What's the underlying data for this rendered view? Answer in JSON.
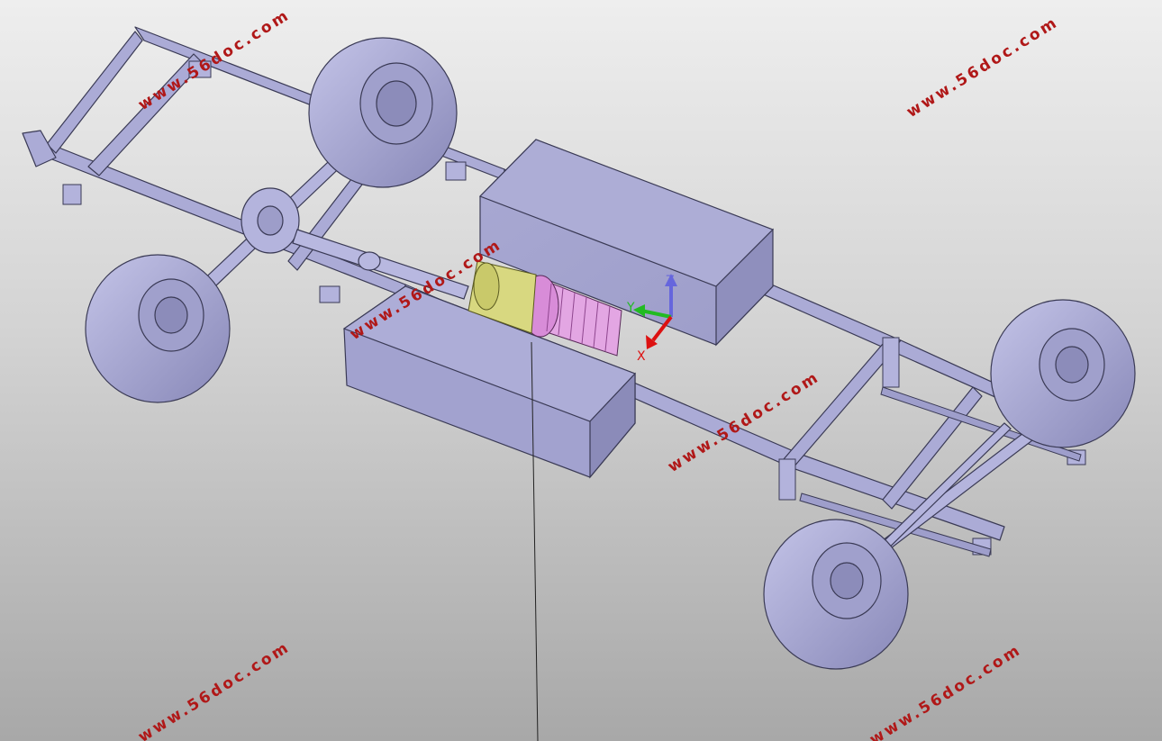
{
  "viewport": {
    "background_top": "#eeeeee",
    "background_bottom": "#a8a8a8",
    "part_color": "#a8a8d4",
    "part_edge": "#3a3a55"
  },
  "watermark": {
    "text": "www.56doc.com",
    "color": "#b01818",
    "count": 7
  },
  "triad": {
    "x_label": "X",
    "y_label": "Y",
    "z_label": "Z",
    "x_color": "#dd1111",
    "y_color": "#22bb22",
    "z_color": "#6666dd"
  },
  "model": {
    "parts": [
      "ladder-frame",
      "front-axle",
      "rear-axle",
      "leaf-springs",
      "drive-shaft",
      "traction-motor",
      "gear-reducer",
      "battery-pack-left",
      "battery-pack-right",
      "wheel"
    ]
  }
}
